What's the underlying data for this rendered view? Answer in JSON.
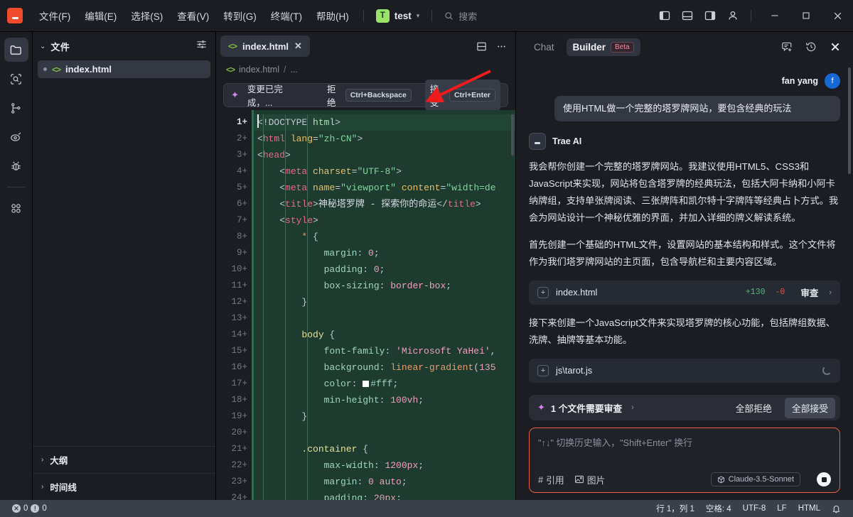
{
  "titlebar": {
    "logo_icon": "trae-logo-icon",
    "menus": [
      "文件(F)",
      "编辑(E)",
      "选择(S)",
      "查看(V)",
      "转到(G)",
      "终端(T)",
      "帮助(H)"
    ],
    "project_badge": "T",
    "project_name": "test",
    "project_caret": "▾",
    "search_placeholder": "搜索",
    "search_icon": "search-icon",
    "layout_icons": [
      "panel-left-icon",
      "panel-bottom-icon",
      "panel-right-icon",
      "account-icon"
    ],
    "window_controls": {
      "minimize": "—",
      "maximize": "▢",
      "close": "✕"
    }
  },
  "activitybar": {
    "items": [
      {
        "name": "explorer",
        "icon": "folder-icon",
        "active": true
      },
      {
        "name": "search",
        "icon": "search-code-icon",
        "active": false
      },
      {
        "name": "source-control",
        "icon": "git-branch-icon",
        "active": false
      },
      {
        "name": "live-preview",
        "icon": "eye-icon",
        "active": false
      },
      {
        "name": "run-and-debug",
        "icon": "bug-icon",
        "active": false
      },
      {
        "name": "extensions",
        "icon": "extensions-icon",
        "active": false
      }
    ]
  },
  "explorer": {
    "chevron": "⌄",
    "title": "文件",
    "filter_icon": "filter-settings-icon",
    "files": [
      {
        "name": "index.html",
        "icon": "html-code-icon",
        "selected": true,
        "modified_dot": true
      }
    ],
    "sections": [
      {
        "chevron": "›",
        "label": "大纲"
      },
      {
        "chevron": "›",
        "label": "时间线"
      }
    ]
  },
  "editor": {
    "tab": {
      "icon": "html-code-icon",
      "label": "index.html",
      "close": "✕"
    },
    "tab_actions": [
      "split-editor-icon",
      "more-actions-icon"
    ],
    "breadcrumb": {
      "icon": "html-code-icon",
      "file": "index.html",
      "sep": "/",
      "rest": "..."
    },
    "changebar": {
      "sparkle_icon": "sparkle-icon",
      "message": "变更已完成，...",
      "reject_label": "拒绝",
      "reject_kbd": "Ctrl+Backspace",
      "accept_label": "接受",
      "accept_kbd": "Ctrl+Enter"
    },
    "collapse_mark": "—",
    "gutter_suffix": "+",
    "lines": [
      {
        "n": 1,
        "cur": true,
        "indent": 0,
        "tokens": [
          {
            "t": "punc",
            "v": "<!DOCTYPE "
          },
          {
            "t": "name",
            "v": "html"
          },
          {
            "t": "punc",
            "v": ">"
          }
        ]
      },
      {
        "n": 2,
        "indent": 0,
        "tokens": [
          {
            "t": "punc",
            "v": "<"
          },
          {
            "t": "tag",
            "v": "html"
          },
          {
            "t": "attr",
            "v": " lang"
          },
          {
            "t": "punc",
            "v": "="
          },
          {
            "t": "str",
            "v": "\"zh-CN\""
          },
          {
            "t": "punc",
            "v": ">"
          }
        ]
      },
      {
        "n": 3,
        "indent": 0,
        "tokens": [
          {
            "t": "punc",
            "v": "<"
          },
          {
            "t": "tag",
            "v": "head"
          },
          {
            "t": "punc",
            "v": ">"
          }
        ]
      },
      {
        "n": 4,
        "indent": 1,
        "tokens": [
          {
            "t": "punc",
            "v": "    <"
          },
          {
            "t": "tag",
            "v": "meta"
          },
          {
            "t": "attr",
            "v": " charset"
          },
          {
            "t": "punc",
            "v": "="
          },
          {
            "t": "str",
            "v": "\"UTF-8\""
          },
          {
            "t": "punc",
            "v": ">"
          }
        ]
      },
      {
        "n": 5,
        "indent": 1,
        "tokens": [
          {
            "t": "punc",
            "v": "    <"
          },
          {
            "t": "tag",
            "v": "meta"
          },
          {
            "t": "attr",
            "v": " name"
          },
          {
            "t": "punc",
            "v": "="
          },
          {
            "t": "str",
            "v": "\"viewport\""
          },
          {
            "t": "attr",
            "v": " content"
          },
          {
            "t": "punc",
            "v": "="
          },
          {
            "t": "str",
            "v": "\"width=de"
          }
        ]
      },
      {
        "n": 6,
        "indent": 1,
        "tokens": [
          {
            "t": "punc",
            "v": "    <"
          },
          {
            "t": "tag",
            "v": "title"
          },
          {
            "t": "punc",
            "v": ">"
          },
          {
            "t": "txt",
            "v": "神秘塔罗牌 - 探索你的命运"
          },
          {
            "t": "punc",
            "v": "</"
          },
          {
            "t": "tag",
            "v": "title"
          },
          {
            "t": "punc",
            "v": ">"
          }
        ]
      },
      {
        "n": 7,
        "indent": 1,
        "tokens": [
          {
            "t": "punc",
            "v": "    <"
          },
          {
            "t": "tag",
            "v": "style"
          },
          {
            "t": "punc",
            "v": ">"
          }
        ]
      },
      {
        "n": 8,
        "indent": 2,
        "tokens": [
          {
            "t": "fn",
            "v": "        *"
          },
          {
            "t": "punc",
            "v": " {"
          }
        ]
      },
      {
        "n": 9,
        "indent": 3,
        "tokens": [
          {
            "t": "prop",
            "v": "            margin"
          },
          {
            "t": "punc",
            "v": ": "
          },
          {
            "t": "val",
            "v": "0"
          },
          {
            "t": "punc",
            "v": ";"
          }
        ]
      },
      {
        "n": 10,
        "indent": 3,
        "tokens": [
          {
            "t": "prop",
            "v": "            padding"
          },
          {
            "t": "punc",
            "v": ": "
          },
          {
            "t": "val",
            "v": "0"
          },
          {
            "t": "punc",
            "v": ";"
          }
        ]
      },
      {
        "n": 11,
        "indent": 3,
        "tokens": [
          {
            "t": "prop",
            "v": "            box-sizing"
          },
          {
            "t": "punc",
            "v": ": "
          },
          {
            "t": "val",
            "v": "border-box"
          },
          {
            "t": "punc",
            "v": ";"
          }
        ]
      },
      {
        "n": 12,
        "indent": 2,
        "tokens": [
          {
            "t": "punc",
            "v": "        }"
          }
        ]
      },
      {
        "n": 13,
        "indent": 0,
        "tokens": []
      },
      {
        "n": 14,
        "indent": 2,
        "tokens": [
          {
            "t": "sel",
            "v": "        body"
          },
          {
            "t": "punc",
            "v": " {"
          }
        ]
      },
      {
        "n": 15,
        "indent": 3,
        "tokens": [
          {
            "t": "prop",
            "v": "            font-family"
          },
          {
            "t": "punc",
            "v": ": "
          },
          {
            "t": "val",
            "v": "'Microsoft YaHei'"
          },
          {
            "t": "punc",
            "v": ","
          }
        ]
      },
      {
        "n": 16,
        "indent": 3,
        "tokens": [
          {
            "t": "prop",
            "v": "            background"
          },
          {
            "t": "punc",
            "v": ": "
          },
          {
            "t": "fn",
            "v": "linear-gradient"
          },
          {
            "t": "punc",
            "v": "("
          },
          {
            "t": "val",
            "v": "135"
          }
        ]
      },
      {
        "n": 17,
        "indent": 3,
        "tokens": [
          {
            "t": "prop",
            "v": "            color"
          },
          {
            "t": "punc",
            "v": ": "
          },
          {
            "t": "swatch",
            "v": ""
          },
          {
            "t": "val2",
            "v": "#fff"
          },
          {
            "t": "punc",
            "v": ";"
          }
        ]
      },
      {
        "n": 18,
        "indent": 3,
        "tokens": [
          {
            "t": "prop",
            "v": "            min-height"
          },
          {
            "t": "punc",
            "v": ": "
          },
          {
            "t": "val",
            "v": "100vh"
          },
          {
            "t": "punc",
            "v": ";"
          }
        ]
      },
      {
        "n": 19,
        "indent": 2,
        "tokens": [
          {
            "t": "punc",
            "v": "        }"
          }
        ]
      },
      {
        "n": 20,
        "indent": 0,
        "tokens": []
      },
      {
        "n": 21,
        "indent": 2,
        "tokens": [
          {
            "t": "sel",
            "v": "        .container"
          },
          {
            "t": "punc",
            "v": " {"
          }
        ]
      },
      {
        "n": 22,
        "indent": 3,
        "tokens": [
          {
            "t": "prop",
            "v": "            max-width"
          },
          {
            "t": "punc",
            "v": ": "
          },
          {
            "t": "val",
            "v": "1200px"
          },
          {
            "t": "punc",
            "v": ";"
          }
        ]
      },
      {
        "n": 23,
        "indent": 3,
        "tokens": [
          {
            "t": "prop",
            "v": "            margin"
          },
          {
            "t": "punc",
            "v": ": "
          },
          {
            "t": "val",
            "v": "0 auto"
          },
          {
            "t": "punc",
            "v": ";"
          }
        ]
      },
      {
        "n": 24,
        "indent": 3,
        "tokens": [
          {
            "t": "prop",
            "v": "            padding"
          },
          {
            "t": "punc",
            "v": ": "
          },
          {
            "t": "val",
            "v": "20px"
          },
          {
            "t": "punc",
            "v": ";"
          }
        ]
      }
    ]
  },
  "chat": {
    "tabs": [
      {
        "label": "Chat",
        "active": false
      },
      {
        "label": "Builder",
        "badge": "Beta",
        "active": true
      }
    ],
    "header_icons": [
      "new-chat-icon",
      "history-icon",
      "close-icon"
    ],
    "user": {
      "name": "fan yang",
      "avatar_letter": "f"
    },
    "user_message": "使用HTML做一个完整的塔罗牌网站，要包含经典的玩法",
    "ai": {
      "name": "Trae AI",
      "logo_icon": "trae-logo-icon"
    },
    "messages": [
      "我会帮你创建一个完整的塔罗牌网站。我建议使用HTML5、CSS3和JavaScript来实现，网站将包含塔罗牌的经典玩法，包括大阿卡纳和小阿卡纳牌组，支持单张牌阅读、三张牌阵和凯尔特十字牌阵等经典占卜方式。我会为网站设计一个神秘优雅的界面，并加入详细的牌义解读系统。",
      "首先创建一个基础的HTML文件，设置网站的基本结构和样式。这个文件将作为我们塔罗牌网站的主页面，包含导航栏和主要内容区域。",
      "接下来创建一个JavaScript文件来实现塔罗牌的核心功能，包括牌组数据、洗牌、抽牌等基本功能。"
    ],
    "file_cards": [
      {
        "plus": "+",
        "name": "index.html",
        "added": "+130",
        "deleted": "-0",
        "review": "审查",
        "arrow": "›",
        "loading": false
      },
      {
        "plus": "+",
        "name": "js\\tarot.js",
        "loading": true
      }
    ],
    "review_bar": {
      "sparkle_icon": "sparkle-icon",
      "label": "1 个文件需要审查",
      "arrow": "›",
      "reject_all": "全部拒绝",
      "accept_all": "全部接受"
    },
    "composer": {
      "placeholder": "\"↑↓\" 切换历史输入，\"Shift+Enter\" 换行",
      "quote_label": "引用",
      "quote_icon": "hash-icon",
      "image_label": "图片",
      "image_icon": "image-icon",
      "model": "Claude-3.5-Sonnet",
      "model_icon": "cube-icon",
      "send_icon": "stop-icon"
    }
  },
  "statusbar": {
    "errors_icon": "error-icon",
    "errors": "0",
    "warnings_icon": "warning-icon",
    "warnings": "0",
    "cursor_position": "行 1，列 1",
    "indentation": "空格: 4",
    "encoding": "UTF-8",
    "eol": "LF",
    "language": "HTML",
    "bell_icon": "bell-icon"
  },
  "annotation": {
    "arrow_color": "#f01c1c",
    "arrow_target": "accept-button"
  },
  "colors": {
    "accent_red": "#f04b2a",
    "diff_added_bg": "#1d3b2e",
    "composer_border": "#e2613f",
    "avatar_blue": "#1668d4",
    "beta_pink": "#f08ca6"
  }
}
